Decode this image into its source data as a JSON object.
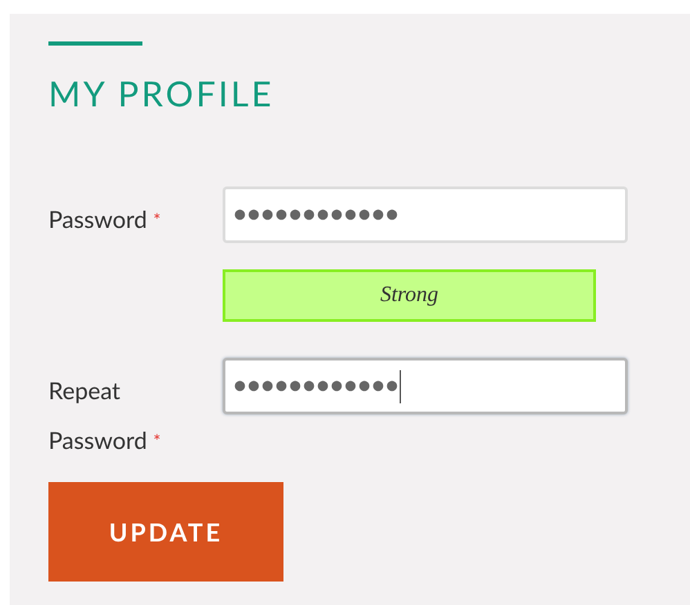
{
  "title": "MY PROFILE",
  "fields": [
    {
      "label": "Password",
      "required_mark": "*",
      "value": "●●●●●●●●●●●●",
      "focused": false
    },
    {
      "label": "Repeat Password",
      "required_mark": "*",
      "value": "●●●●●●●●●●●●",
      "focused": true
    }
  ],
  "strength": {
    "label": "Strong",
    "kind": "strong"
  },
  "button": "UPDATE"
}
